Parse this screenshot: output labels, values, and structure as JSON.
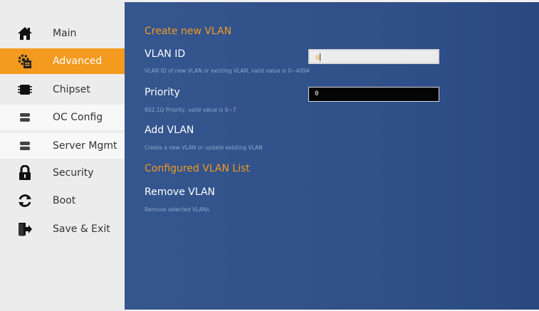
{
  "sidebar": {
    "items": [
      {
        "label": "Main",
        "icon": "home-icon"
      },
      {
        "label": "Advanced",
        "icon": "advanced-icon"
      },
      {
        "label": "Chipset",
        "icon": "chip-icon"
      },
      {
        "label": "OC Config",
        "icon": "storage-icon"
      },
      {
        "label": "Server Mgmt",
        "icon": "server-icon"
      },
      {
        "label": "Security",
        "icon": "lock-icon"
      },
      {
        "label": "Boot",
        "icon": "refresh-icon"
      },
      {
        "label": "Save & Exit",
        "icon": "exit-icon"
      }
    ],
    "active_index": 1
  },
  "main": {
    "create_title": "Create new VLAN",
    "vlan_id": {
      "label": "VLAN ID",
      "value": "0",
      "help": "VLAN ID of new VLAN or existing VLAN, valid value is 0~4094"
    },
    "priority": {
      "label": "Priority",
      "value": "0",
      "help": "802.1Q Priority, valid value is 0~7"
    },
    "add_vlan": {
      "label": "Add VLAN",
      "help": "Create a new VLAN or update existing VLAN"
    },
    "configured_title": "Configured VLAN List",
    "remove_vlan": {
      "label": "Remove VLAN",
      "help": "Remove selected VLANs"
    }
  },
  "colors": {
    "accent": "#f39a1f",
    "panel": "#2e4e87",
    "sidebar": "#ececec"
  }
}
